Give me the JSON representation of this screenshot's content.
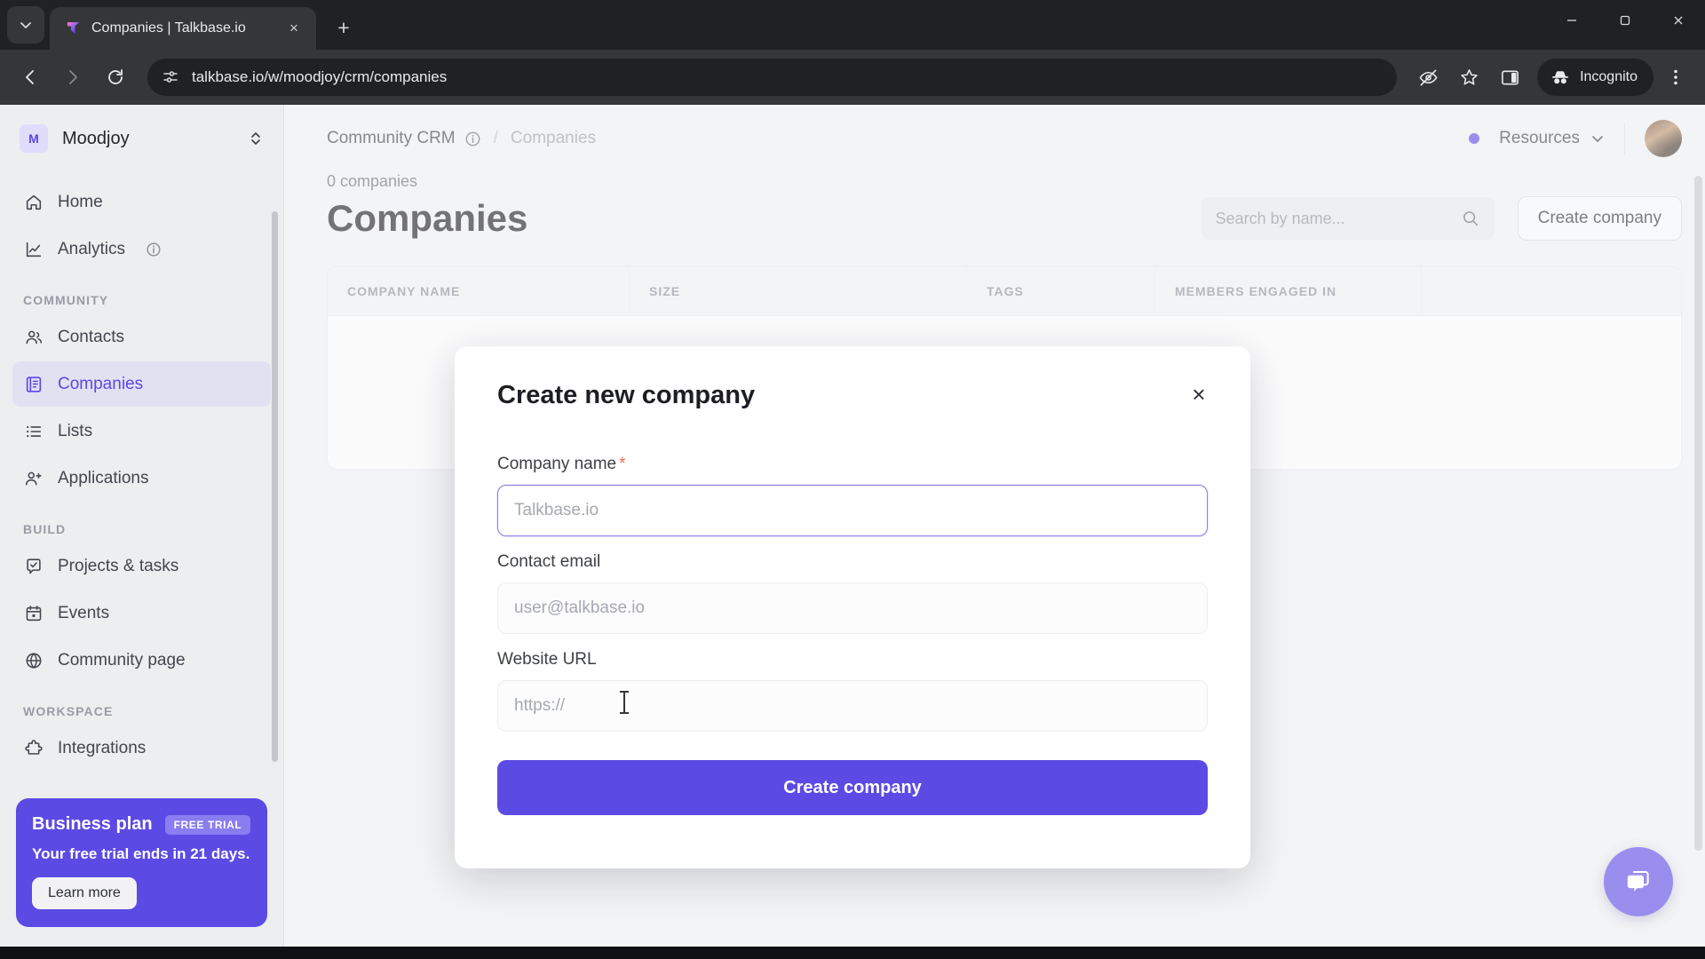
{
  "browser": {
    "tab": {
      "title": "Companies | Talkbase.io",
      "favicon_icon": "talkbase-logo-icon",
      "close_icon": "×"
    },
    "tab_list_icon": "chevron-down-icon",
    "new_tab_icon": "+",
    "window_controls": {
      "minimize": "—",
      "maximize": "❐",
      "close": "✕"
    },
    "nav": {
      "back_icon": "arrow-left-icon",
      "forward_icon": "arrow-right-icon",
      "reload_icon": "reload-icon"
    },
    "omnibox": {
      "site_info_icon": "page-settings-icon",
      "url": "talkbase.io/w/moodjoy/crm/companies"
    },
    "toolbar_icons": [
      "eye-off-icon",
      "star-icon",
      "side-panel-icon"
    ],
    "incognito": {
      "label": "Incognito",
      "icon": "incognito-hat-icon"
    },
    "menu_icon": "three-dot-menu-icon"
  },
  "sidebar": {
    "workspace": {
      "badge": "M",
      "name": "Moodjoy",
      "switch_icon": "chevron-up-down-icon"
    },
    "top_items": [
      {
        "label": "Home",
        "icon": "home-icon"
      },
      {
        "label": "Analytics",
        "icon": "chart-line-icon",
        "info_icon": "info-icon"
      }
    ],
    "sections": [
      {
        "title": "COMMUNITY",
        "items": [
          {
            "label": "Contacts",
            "icon": "users-icon",
            "active": false
          },
          {
            "label": "Companies",
            "icon": "building-icon",
            "active": true
          },
          {
            "label": "Lists",
            "icon": "list-icon",
            "active": false
          },
          {
            "label": "Applications",
            "icon": "user-plus-icon",
            "active": false
          }
        ]
      },
      {
        "title": "BUILD",
        "items": [
          {
            "label": "Projects & tasks",
            "icon": "check-square-icon",
            "active": false
          },
          {
            "label": "Events",
            "icon": "calendar-icon",
            "active": false
          },
          {
            "label": "Community page",
            "icon": "globe-icon",
            "active": false
          }
        ]
      },
      {
        "title": "WORKSPACE",
        "items": [
          {
            "label": "Integrations",
            "icon": "puzzle-icon",
            "active": false
          }
        ]
      }
    ],
    "promo": {
      "title": "Business plan",
      "badge": "FREE TRIAL",
      "subtitle": "Your free trial ends in 21 days.",
      "button": "Learn more"
    }
  },
  "header": {
    "breadcrumb": {
      "root": "Community CRM",
      "info_icon": "info-icon",
      "separator": "/",
      "current": "Companies"
    },
    "status_dot_color": "#5b4ae4",
    "resources": {
      "label": "Resources",
      "chevron_icon": "chevron-down-icon"
    },
    "avatar_name": "user-avatar"
  },
  "page": {
    "count": "0 companies",
    "title": "Companies",
    "search": {
      "placeholder": "Search by name...",
      "icon": "search-icon"
    },
    "create_button": "Create company",
    "table": {
      "columns": [
        "COMPANY NAME",
        "SIZE",
        "TAGS",
        "MEMBERS ENGAGED IN"
      ]
    },
    "chat_icon": "chat-bubble-icon"
  },
  "modal": {
    "title": "Create new company",
    "close_icon": "×",
    "fields": [
      {
        "label": "Company name",
        "required": true,
        "required_mark": "*",
        "value": "",
        "placeholder": "Talkbase.io",
        "focused": true
      },
      {
        "label": "Contact email",
        "required": false,
        "value": "",
        "placeholder": "user@talkbase.io",
        "focused": false
      },
      {
        "label": "Website URL",
        "required": false,
        "value": "",
        "placeholder": "https://",
        "focused": false
      }
    ],
    "submit_label": "Create company",
    "accent_color": "#5b4ae4"
  }
}
